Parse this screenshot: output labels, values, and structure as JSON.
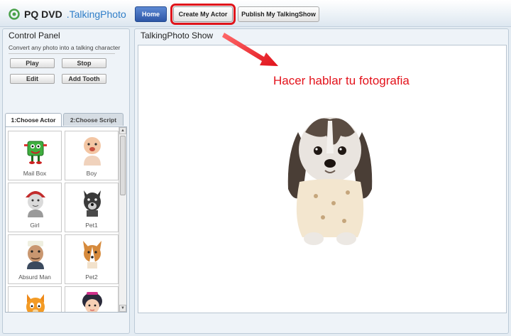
{
  "header": {
    "brand_name": "PQ DVD",
    "brand_product": ".TalkingPhoto",
    "nav": {
      "home": "Home",
      "create": "Create My Actor",
      "publish": "Publish My TalkingShow"
    }
  },
  "control_panel": {
    "title": "Control Panel",
    "description": "Convert any photo into a talking character",
    "buttons": {
      "play": "Play",
      "stop": "Stop",
      "edit": "Edit",
      "add_tooth": "Add Tooth"
    },
    "tabs": {
      "choose_actor": "1:Choose Actor",
      "choose_script": "2:Choose Script"
    },
    "actors": [
      {
        "label": "Mail Box",
        "icon": "mailbox-character-icon"
      },
      {
        "label": "Boy",
        "icon": "baby-boy-icon"
      },
      {
        "label": "Girl",
        "icon": "girl-red-hat-icon"
      },
      {
        "label": "Pet1",
        "icon": "dark-dog-icon"
      },
      {
        "label": "Absurd Man",
        "icon": "absurd-man-icon"
      },
      {
        "label": "Pet2",
        "icon": "corgi-dog-icon"
      },
      {
        "label": "",
        "icon": "orange-cat-icon"
      },
      {
        "label": "",
        "icon": "cartoon-girl-icon"
      }
    ]
  },
  "show": {
    "title": "TalkingPhoto Show",
    "caption": "Hacer hablar tu fotografia"
  },
  "colors": {
    "accent_red": "#e3121b",
    "home_blue": "#2d56a6",
    "brand_blue": "#2f7ec8"
  }
}
